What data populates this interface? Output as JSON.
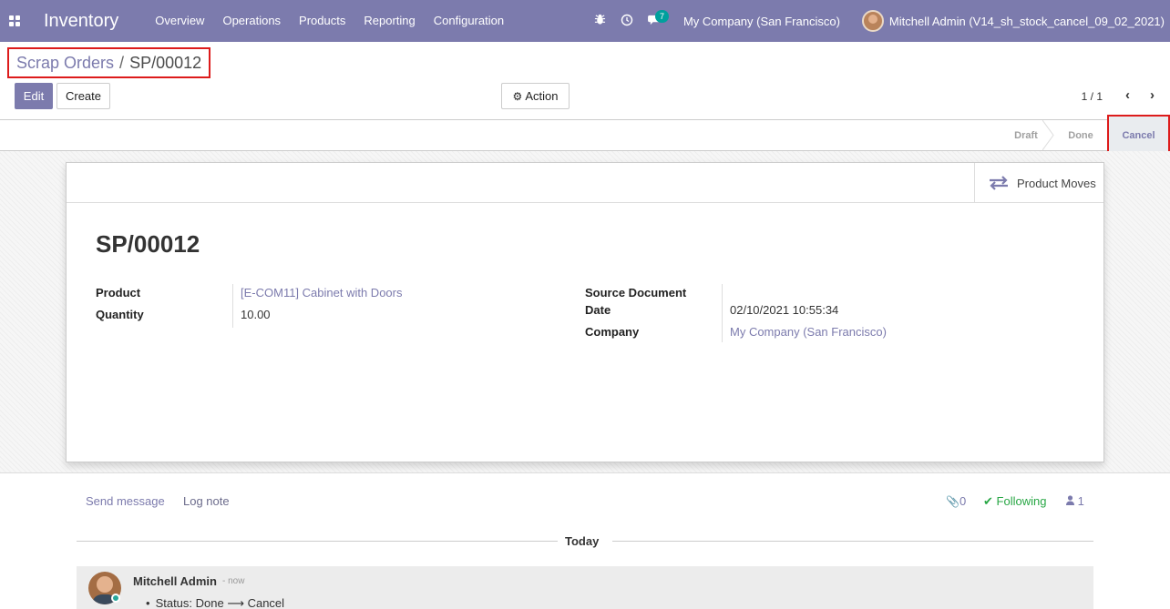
{
  "nav": {
    "app_name": "Inventory",
    "menu": [
      "Overview",
      "Operations",
      "Products",
      "Reporting",
      "Configuration"
    ],
    "messages_count": "7",
    "company": "My Company (San Francisco)",
    "user": "Mitchell Admin (V14_sh_stock_cancel_09_02_2021)",
    "icons": [
      "apps-icon",
      "bug-icon",
      "clock-icon",
      "chat-icon"
    ]
  },
  "breadcrumb": {
    "parent": "Scrap Orders",
    "separator": "/",
    "current": "SP/00012"
  },
  "toolbar": {
    "edit_label": "Edit",
    "create_label": "Create",
    "action_label": "Action",
    "pager": "1 / 1"
  },
  "status": {
    "stages": [
      "Draft",
      "Done",
      "Cancel"
    ],
    "active": "Cancel"
  },
  "sheet": {
    "smart_button": "Product Moves",
    "title": "SP/00012",
    "left": [
      {
        "label": "Product",
        "value": "[E-COM11] Cabinet with Doors"
      },
      {
        "label": "Quantity",
        "value": "10.00"
      }
    ],
    "right": [
      {
        "label": "Source Document",
        "value": ""
      },
      {
        "label": "Date",
        "value": "02/10/2021 10:55:34"
      },
      {
        "label": "Company",
        "value": "My Company (San Francisco)"
      }
    ]
  },
  "chatter": {
    "send_message": "Send message",
    "log_note": "Log note",
    "attachments": "0",
    "following": "Following",
    "followers": "1",
    "separator": "Today",
    "message": {
      "author": "Mitchell Admin",
      "time": "- now",
      "tracking": "Status: Done ⟶ Cancel"
    }
  },
  "colors": {
    "brand": "#7c7bad",
    "highlight": "#dd1b1b",
    "following": "#28a745"
  }
}
